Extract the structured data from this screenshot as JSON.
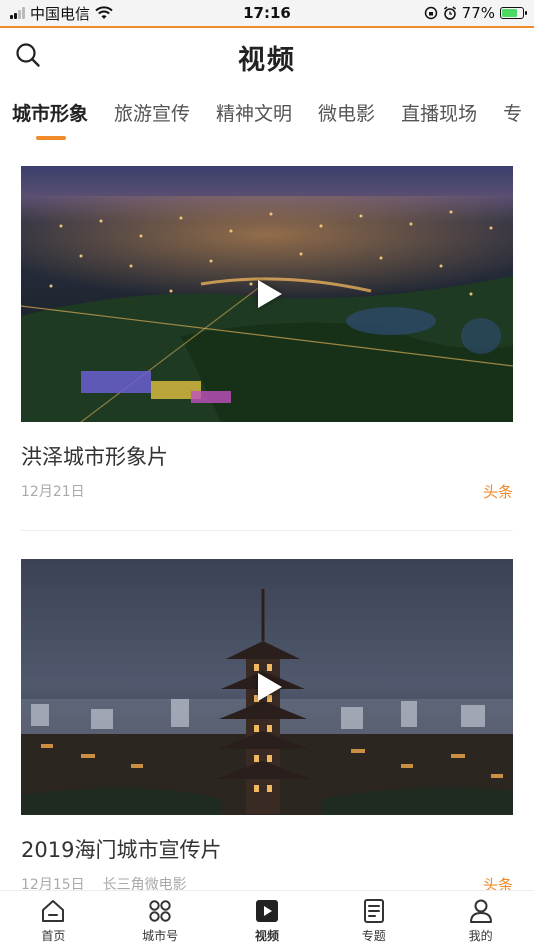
{
  "status": {
    "carrier": "中国电信",
    "time": "17:16",
    "battery": "77%",
    "battery_level": 0.77
  },
  "header": {
    "title": "视频",
    "search_icon": "search-icon"
  },
  "tabs": [
    {
      "label": "城市形象",
      "active": true
    },
    {
      "label": "旅游宣传",
      "active": false
    },
    {
      "label": "精神文明",
      "active": false
    },
    {
      "label": "微电影",
      "active": false
    },
    {
      "label": "直播现场",
      "active": false
    },
    {
      "label": "专",
      "active": false
    }
  ],
  "videos": [
    {
      "title": "洪泽城市形象片",
      "date": "12月21日",
      "source": "",
      "tag": "头条"
    },
    {
      "title": "2019海门城市宣传片",
      "date": "12月15日",
      "source": "长三角微电影",
      "tag": "头条"
    }
  ],
  "bottom_nav": [
    {
      "label": "首页",
      "icon": "home-icon",
      "active": false
    },
    {
      "label": "城市号",
      "icon": "grid-icon",
      "active": false
    },
    {
      "label": "视频",
      "icon": "video-icon",
      "active": true
    },
    {
      "label": "专题",
      "icon": "document-icon",
      "active": false
    },
    {
      "label": "我的",
      "icon": "user-icon",
      "active": false
    }
  ],
  "colors": {
    "accent": "#f08a2a",
    "status_bar": "#f4f4f4"
  }
}
